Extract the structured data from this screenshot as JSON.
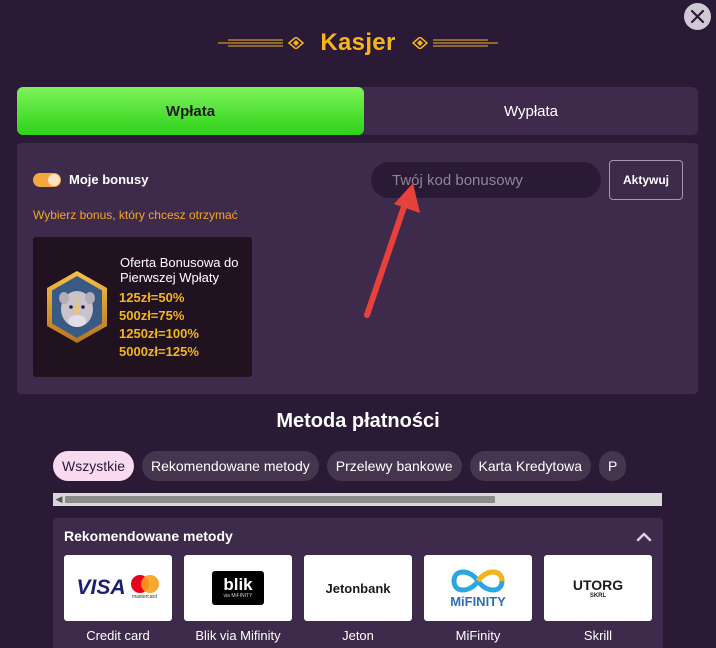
{
  "header": {
    "title": "Kasjer"
  },
  "tabs": [
    {
      "label": "Wpłata",
      "active": true
    },
    {
      "label": "Wypłata",
      "active": false
    }
  ],
  "bonus": {
    "toggle_label": "Moje bonusy",
    "toggle_on": true,
    "hint": "Wybierz bonus, który chcesz otrzymać",
    "code_placeholder": "Twój kod bonusowy",
    "activate_label": "Aktywuj",
    "offer": {
      "title": "Oferta Bonusowa do Pierwszej Wpłaty",
      "lines": [
        "125zł=50%",
        "500zł=75%",
        "1250zł=100%",
        "5000zł=125%"
      ]
    }
  },
  "payment": {
    "title": "Metoda płatności",
    "filters": [
      "Wszystkie",
      "Rekomendowane metody",
      "Przelewy bankowe",
      "Karta Kredytowa",
      "P"
    ],
    "section_title": "Rekomendowane metody",
    "methods": [
      {
        "label": "Credit card",
        "logo_text": "VISA",
        "logo_sub": "mastercard"
      },
      {
        "label": "Blik via Mifinity",
        "logo_text": "blik",
        "logo_sub": "via MiFINITY"
      },
      {
        "label": "Jeton",
        "logo_text": "Jetonbank"
      },
      {
        "label": "MiFinity",
        "logo_text": "MiFINITY"
      },
      {
        "label": "Skrill",
        "logo_text": "UTORG",
        "logo_sub": "SKRL"
      }
    ]
  },
  "colors": {
    "accent": "#f5b51b",
    "green": "#3fd725",
    "bg": "#2b1a36",
    "panel": "#3e2a4b",
    "annotation_arrow": "#e8413a"
  }
}
